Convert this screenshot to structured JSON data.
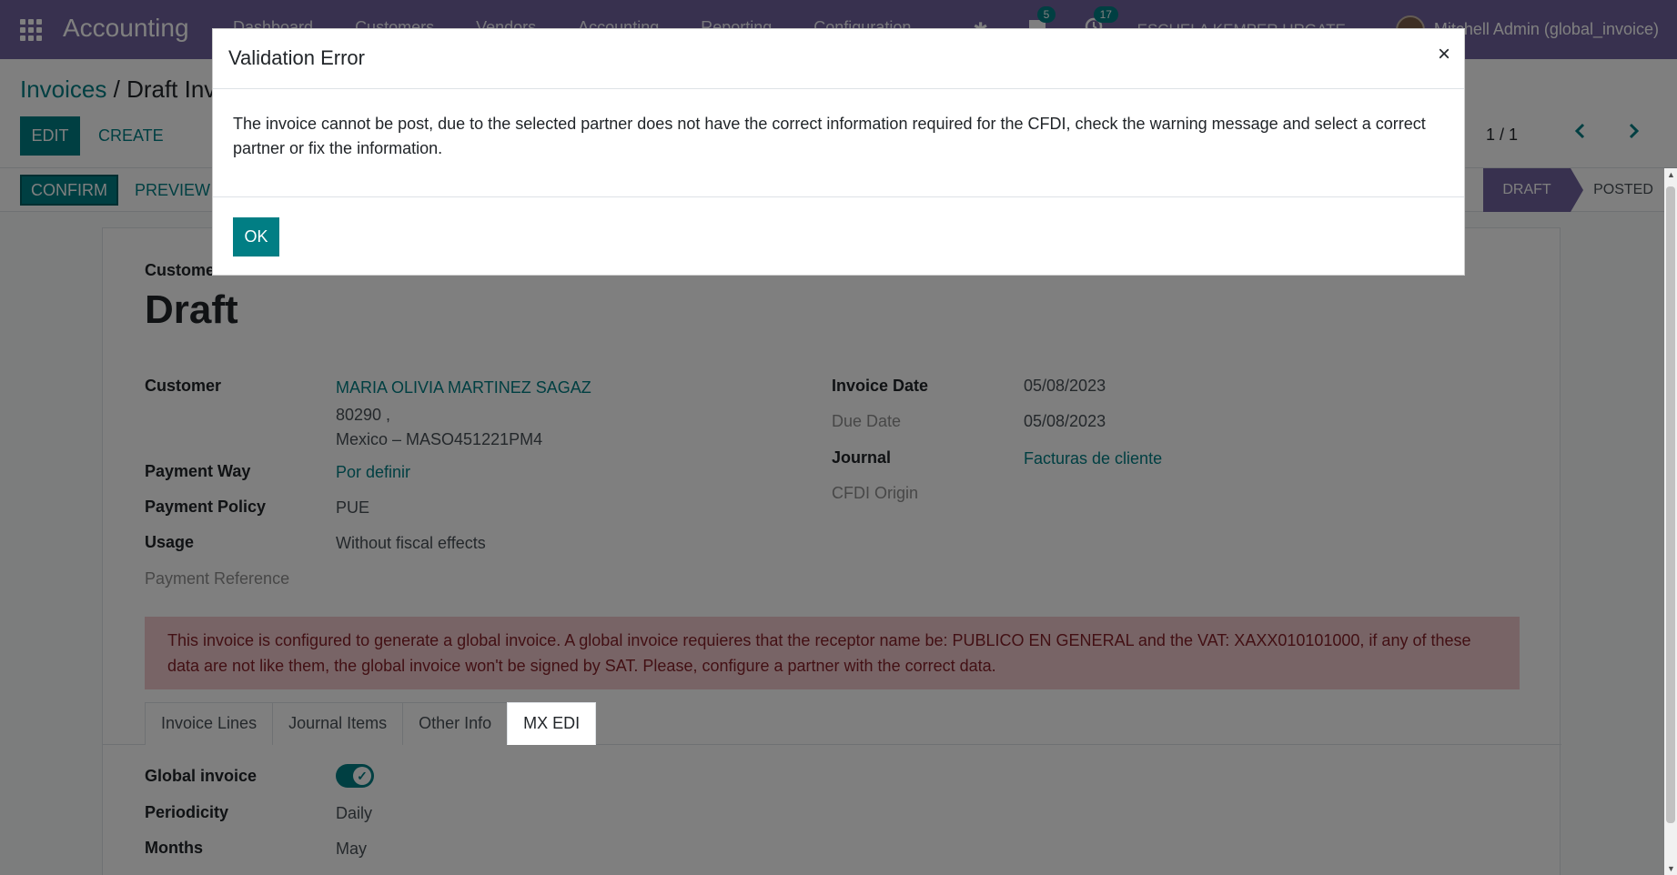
{
  "navbar": {
    "brand": "Accounting",
    "menu": [
      "Dashboard",
      "Customers",
      "Vendors",
      "Accounting",
      "Reporting",
      "Configuration"
    ],
    "bug_icon": "bug-icon",
    "messages_badge": "5",
    "activities_badge": "17",
    "company": "ESCUELA KEMPER URGATE",
    "user": "Mitchell Admin (global_invoice)"
  },
  "control_panel": {
    "breadcrumb_parent": "Invoices",
    "breadcrumb_sep": " / ",
    "breadcrumb_current": "Draft Invoice",
    "edit_label": "EDIT",
    "create_label": "CREATE",
    "pager": "1 / 1"
  },
  "statusbar": {
    "confirm_label": "CONFIRM",
    "preview_label": "PREVIEW",
    "stages": [
      "DRAFT",
      "POSTED"
    ],
    "active_stage": "DRAFT"
  },
  "form": {
    "type": "Customer Invoice",
    "title": "Draft",
    "customer_label": "Customer",
    "customer_name": "MARIA OLIVIA MARTINEZ SAGAZ",
    "customer_zip": "80290 ,",
    "customer_country_vat": "Mexico – MASO451221PM4",
    "payment_way_label": "Payment Way",
    "payment_way": "Por definir",
    "payment_policy_label": "Payment Policy",
    "payment_policy": "PUE",
    "usage_label": "Usage",
    "usage": "Without fiscal effects",
    "payment_reference_label": "Payment Reference",
    "invoice_date_label": "Invoice Date",
    "invoice_date": "05/08/2023",
    "due_date_label": "Due Date",
    "due_date": "05/08/2023",
    "journal_label": "Journal",
    "journal": "Facturas de cliente",
    "cfdi_origin_label": "CFDI Origin",
    "alert": "This invoice is configured to generate a global invoice. A global invoice requieres that the receptor name be: PUBLICO EN GENERAL and the VAT: XAXX010101000, if any of these data are not like them, the global invoice won't be signed by SAT. Please, configure a partner with the correct data.",
    "tabs": [
      "Invoice Lines",
      "Journal Items",
      "Other Info",
      "MX EDI"
    ],
    "active_tab": "MX EDI",
    "global_invoice_label": "Global invoice",
    "global_invoice_on": true,
    "periodicity_label": "Periodicity",
    "periodicity": "Daily",
    "months_label": "Months",
    "months": "May"
  },
  "modal": {
    "title": "Validation Error",
    "close": "×",
    "message": "The invoice cannot be post, due to the selected partner does not have the correct information required for the CFDI, check the warning message and select a correct partner or fix the information.",
    "ok_label": "OK"
  },
  "colors": {
    "navbar": "#71639e",
    "primary": "#017e84",
    "alert_bg": "#f1c9cc",
    "alert_text": "#842029"
  }
}
